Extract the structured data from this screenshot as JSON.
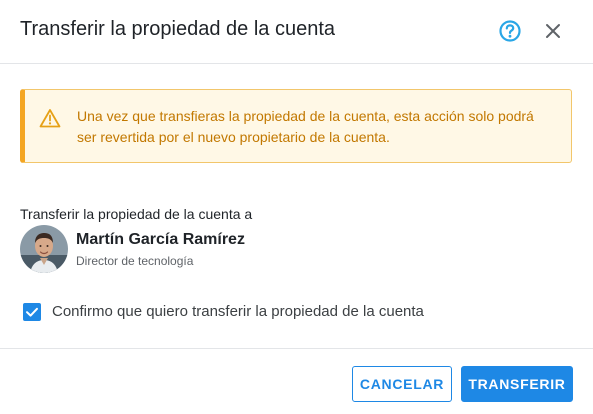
{
  "dialog": {
    "title": "Transferir la propiedad de la cuenta",
    "help_icon": "help-circle-icon",
    "close_icon": "close-icon"
  },
  "warning": {
    "icon": "warning-triangle-icon",
    "text": "Una vez que transfieras la propiedad de la cuenta, esta acción solo podrá ser revertida por el nuevo propietario de la cuenta."
  },
  "transfer_to": {
    "label": "Transferir la propiedad de la cuenta a",
    "user": {
      "name": "Martín García Ramírez",
      "role": "Director de tecnología"
    }
  },
  "confirm": {
    "checked": true,
    "label": "Confirmo que quiero transferir la propiedad de la cuenta"
  },
  "buttons": {
    "cancel": "CANCELAR",
    "transfer": "TRANSFERIR"
  },
  "colors": {
    "accent": "#1e88e5",
    "warning_border": "#f4a623",
    "warning_text": "#c27800",
    "help_icon": "#29a6e6"
  }
}
